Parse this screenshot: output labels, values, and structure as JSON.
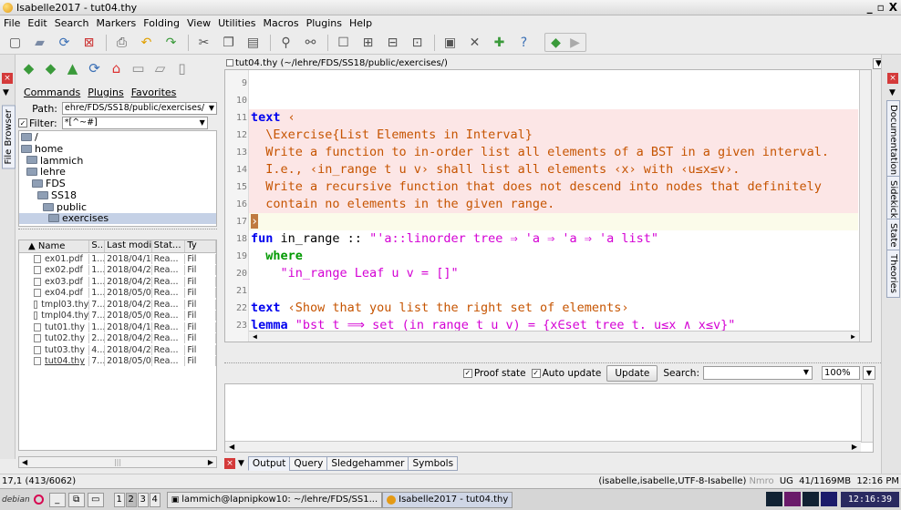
{
  "window": {
    "title": "Isabelle2017 - tut04.thy"
  },
  "menubar": [
    "File",
    "Edit",
    "Search",
    "Markers",
    "Folding",
    "View",
    "Utilities",
    "Macros",
    "Plugins",
    "Help"
  ],
  "left_dock": {
    "tab": "File Browser"
  },
  "file_browser": {
    "menu": [
      "Commands",
      "Plugins",
      "Favorites"
    ],
    "path_label": "Path:",
    "path_value": "ehre/FDS/SS18/public/exercises/",
    "filter_label": "Filter:",
    "filter_value": "*[^~#]",
    "tree": [
      "/",
      "home",
      "lammich",
      "lehre",
      "FDS",
      "SS18",
      "public",
      "exercises"
    ],
    "columns": [
      "▲ Name",
      "S...",
      "Last modifi...",
      "Stat...",
      "Ty"
    ],
    "files": [
      {
        "name": "ex01.pdf",
        "size": "1...",
        "modified": "2018/04/1...",
        "status": "Rea...",
        "type": "Fil"
      },
      {
        "name": "ex02.pdf",
        "size": "1...",
        "modified": "2018/04/2...",
        "status": "Rea...",
        "type": "Fil"
      },
      {
        "name": "ex03.pdf",
        "size": "1...",
        "modified": "2018/04/2...",
        "status": "Rea...",
        "type": "Fil"
      },
      {
        "name": "ex04.pdf",
        "size": "1...",
        "modified": "2018/05/0...",
        "status": "Rea...",
        "type": "Fil"
      },
      {
        "name": "tmpl03.thy",
        "size": "7...",
        "modified": "2018/04/2...",
        "status": "Rea...",
        "type": "Fil"
      },
      {
        "name": "tmpl04.thy",
        "size": "7...",
        "modified": "2018/05/0...",
        "status": "Rea...",
        "type": "Fil"
      },
      {
        "name": "tut01.thy",
        "size": "1...",
        "modified": "2018/04/1...",
        "status": "Rea...",
        "type": "Fil"
      },
      {
        "name": "tut02.thy",
        "size": "2...",
        "modified": "2018/04/2...",
        "status": "Rea...",
        "type": "Fil"
      },
      {
        "name": "tut03.thy",
        "size": "4...",
        "modified": "2018/04/2...",
        "status": "Rea...",
        "type": "Fil"
      },
      {
        "name": "tut04.thy",
        "size": "7...",
        "modified": "2018/05/0...",
        "status": "Rea...",
        "type": "Fil"
      }
    ]
  },
  "editor": {
    "title": "tut04.thy (~/lehre/FDS/SS18/public/exercises/)",
    "lines": [
      {
        "n": "9",
        "parts": []
      },
      {
        "n": "10",
        "parts": []
      },
      {
        "n": "11",
        "parts": [
          [
            "kw",
            "text"
          ],
          [
            "txt",
            " ‹"
          ]
        ]
      },
      {
        "n": "12",
        "parts": [
          [
            "txt",
            "  \\Exercise{List Elements in Interval}"
          ]
        ]
      },
      {
        "n": "13",
        "parts": [
          [
            "txt",
            "  Write a function to in-order list all elements of a BST in a given interval."
          ]
        ]
      },
      {
        "n": "14",
        "parts": [
          [
            "txt",
            "  I.e., ‹in_range t u v› shall list all elements ‹x› with ‹u≤x≤v›."
          ]
        ]
      },
      {
        "n": "15",
        "parts": [
          [
            "txt",
            "  Write a recursive function that does not descend into nodes that definitely"
          ]
        ]
      },
      {
        "n": "16",
        "parts": [
          [
            "txt",
            "  contain no elements in the given range."
          ]
        ]
      },
      {
        "n": "17",
        "parts": [
          [
            "txt",
            "›"
          ]
        ]
      },
      {
        "n": "18",
        "parts": [
          [
            "kw",
            "fun"
          ],
          [
            "plain",
            " in_range :: "
          ],
          [
            "str",
            "\"'a::linorder tree ⇒ 'a ⇒ 'a ⇒ 'a list\""
          ]
        ]
      },
      {
        "n": "19",
        "parts": [
          [
            "kw2",
            "  where"
          ]
        ]
      },
      {
        "n": "20",
        "parts": [
          [
            "str",
            "    \"in_range Leaf u v = []\""
          ]
        ]
      },
      {
        "n": "21",
        "parts": []
      },
      {
        "n": "22",
        "parts": [
          [
            "kw",
            "text"
          ],
          [
            "txt",
            " ‹Show that you list the right set of elements›"
          ]
        ]
      },
      {
        "n": "23",
        "parts": [
          [
            "kw",
            "lemma"
          ],
          [
            "plain",
            " "
          ],
          [
            "str",
            "\"bst t ⟹ set (in_range t u v) = {x∈set_tree t. u≤x ∧ x≤v}\""
          ]
        ]
      }
    ]
  },
  "right_dock": {
    "tabs": [
      "Documentation",
      "Sidekick",
      "State",
      "Theories"
    ]
  },
  "output": {
    "proof_state_label": "Proof state",
    "auto_update_label": "Auto update",
    "update_button": "Update",
    "search_label": "Search:",
    "zoom": "100%",
    "tabs": [
      "Output",
      "Query",
      "Sledgehammer",
      "Symbols"
    ]
  },
  "statusbar": {
    "position": "17,1 (413/6062)",
    "mode": "(isabelle,isabelle,UTF-8-Isabelle)",
    "flags": "Nmro",
    "flags2": "UG",
    "memory": "41/1169MB",
    "time": "12:16 PM"
  },
  "taskbar": {
    "start": "debian",
    "workspaces": [
      "1",
      "2",
      "3",
      "4"
    ],
    "tasks": [
      "lammich@lapnipkow10: ~/lehre/FDS/SS1...",
      "Isabelle2017 - tut04.thy"
    ],
    "clock": "12:16:39"
  }
}
